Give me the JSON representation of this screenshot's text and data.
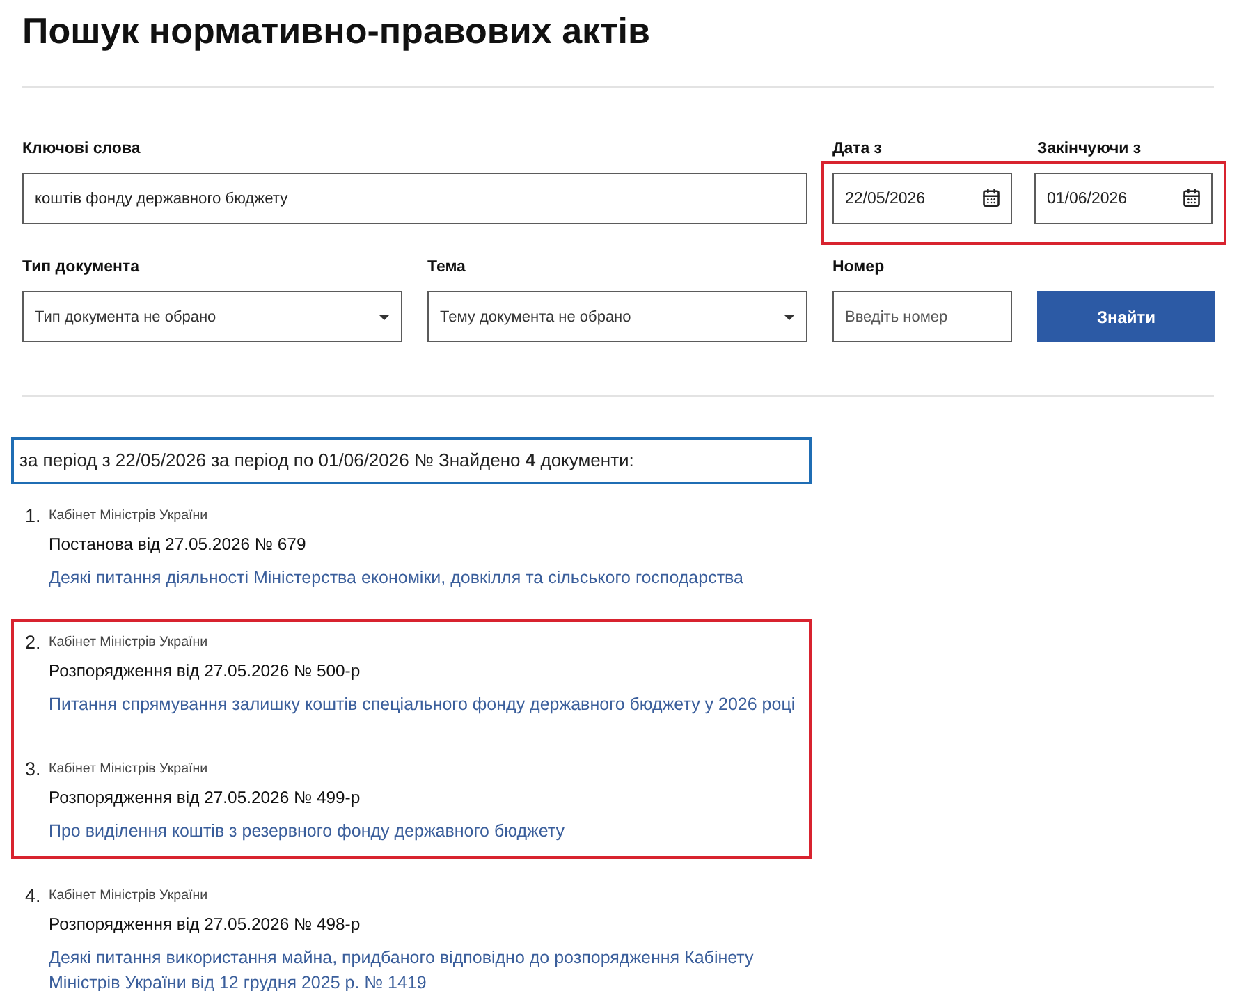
{
  "page": {
    "title": "Пошук нормативно-правових актів"
  },
  "search_form": {
    "keywords": {
      "label": "Ключові слова",
      "value": "коштів фонду державного бюджету"
    },
    "date_range": {
      "highlighted": true,
      "from": {
        "label": "Дата з",
        "value": "22/05/2026"
      },
      "to": {
        "label": "Закінчуючи з",
        "value": "01/06/2026"
      }
    },
    "document_type": {
      "label": "Тип документа",
      "value": "Тип документа не обрано"
    },
    "topic": {
      "label": "Тема",
      "value": "Тему документа не обрано"
    },
    "number": {
      "label": "Номер",
      "placeholder": "Введіть номер"
    },
    "submit_button": "Знайти"
  },
  "summary": {
    "text": "за період з 22/05/2026 за період по 01/06/2026 № Знайдено **4** документи:"
  },
  "results": [
    {
      "number": "1.",
      "issuer": "Кабінет Міністрів України",
      "title": "Постанова від 27.05.2026 № 679",
      "link": "Деякі питання діяльності Міністерства економіки, довкілля та сільського господарства",
      "highlighted": false
    },
    {
      "number": "2.",
      "issuer": "Кабінет Міністрів України",
      "title": "Розпорядження від 27.05.2026 № 500-р",
      "link": "Питання спрямування залишку коштів спеціального фонду державного бюджету у 2026 році",
      "highlighted": true
    },
    {
      "number": "3.",
      "issuer": "Кабінет Міністрів України",
      "title": "Розпорядження від 27.05.2026 № 499-р",
      "link": "Про виділення коштів з резервного фонду державного бюджету",
      "highlighted": true
    },
    {
      "number": "4.",
      "issuer": "Кабінет Міністрів України",
      "title": "Розпорядження від 27.05.2026 № 498-р",
      "link": "Деякі питання використання майна, придбаного відповідно до розпорядження Кабінету Міністрів України від 12 грудня 2025 р. № 1419",
      "highlighted": false
    }
  ]
}
